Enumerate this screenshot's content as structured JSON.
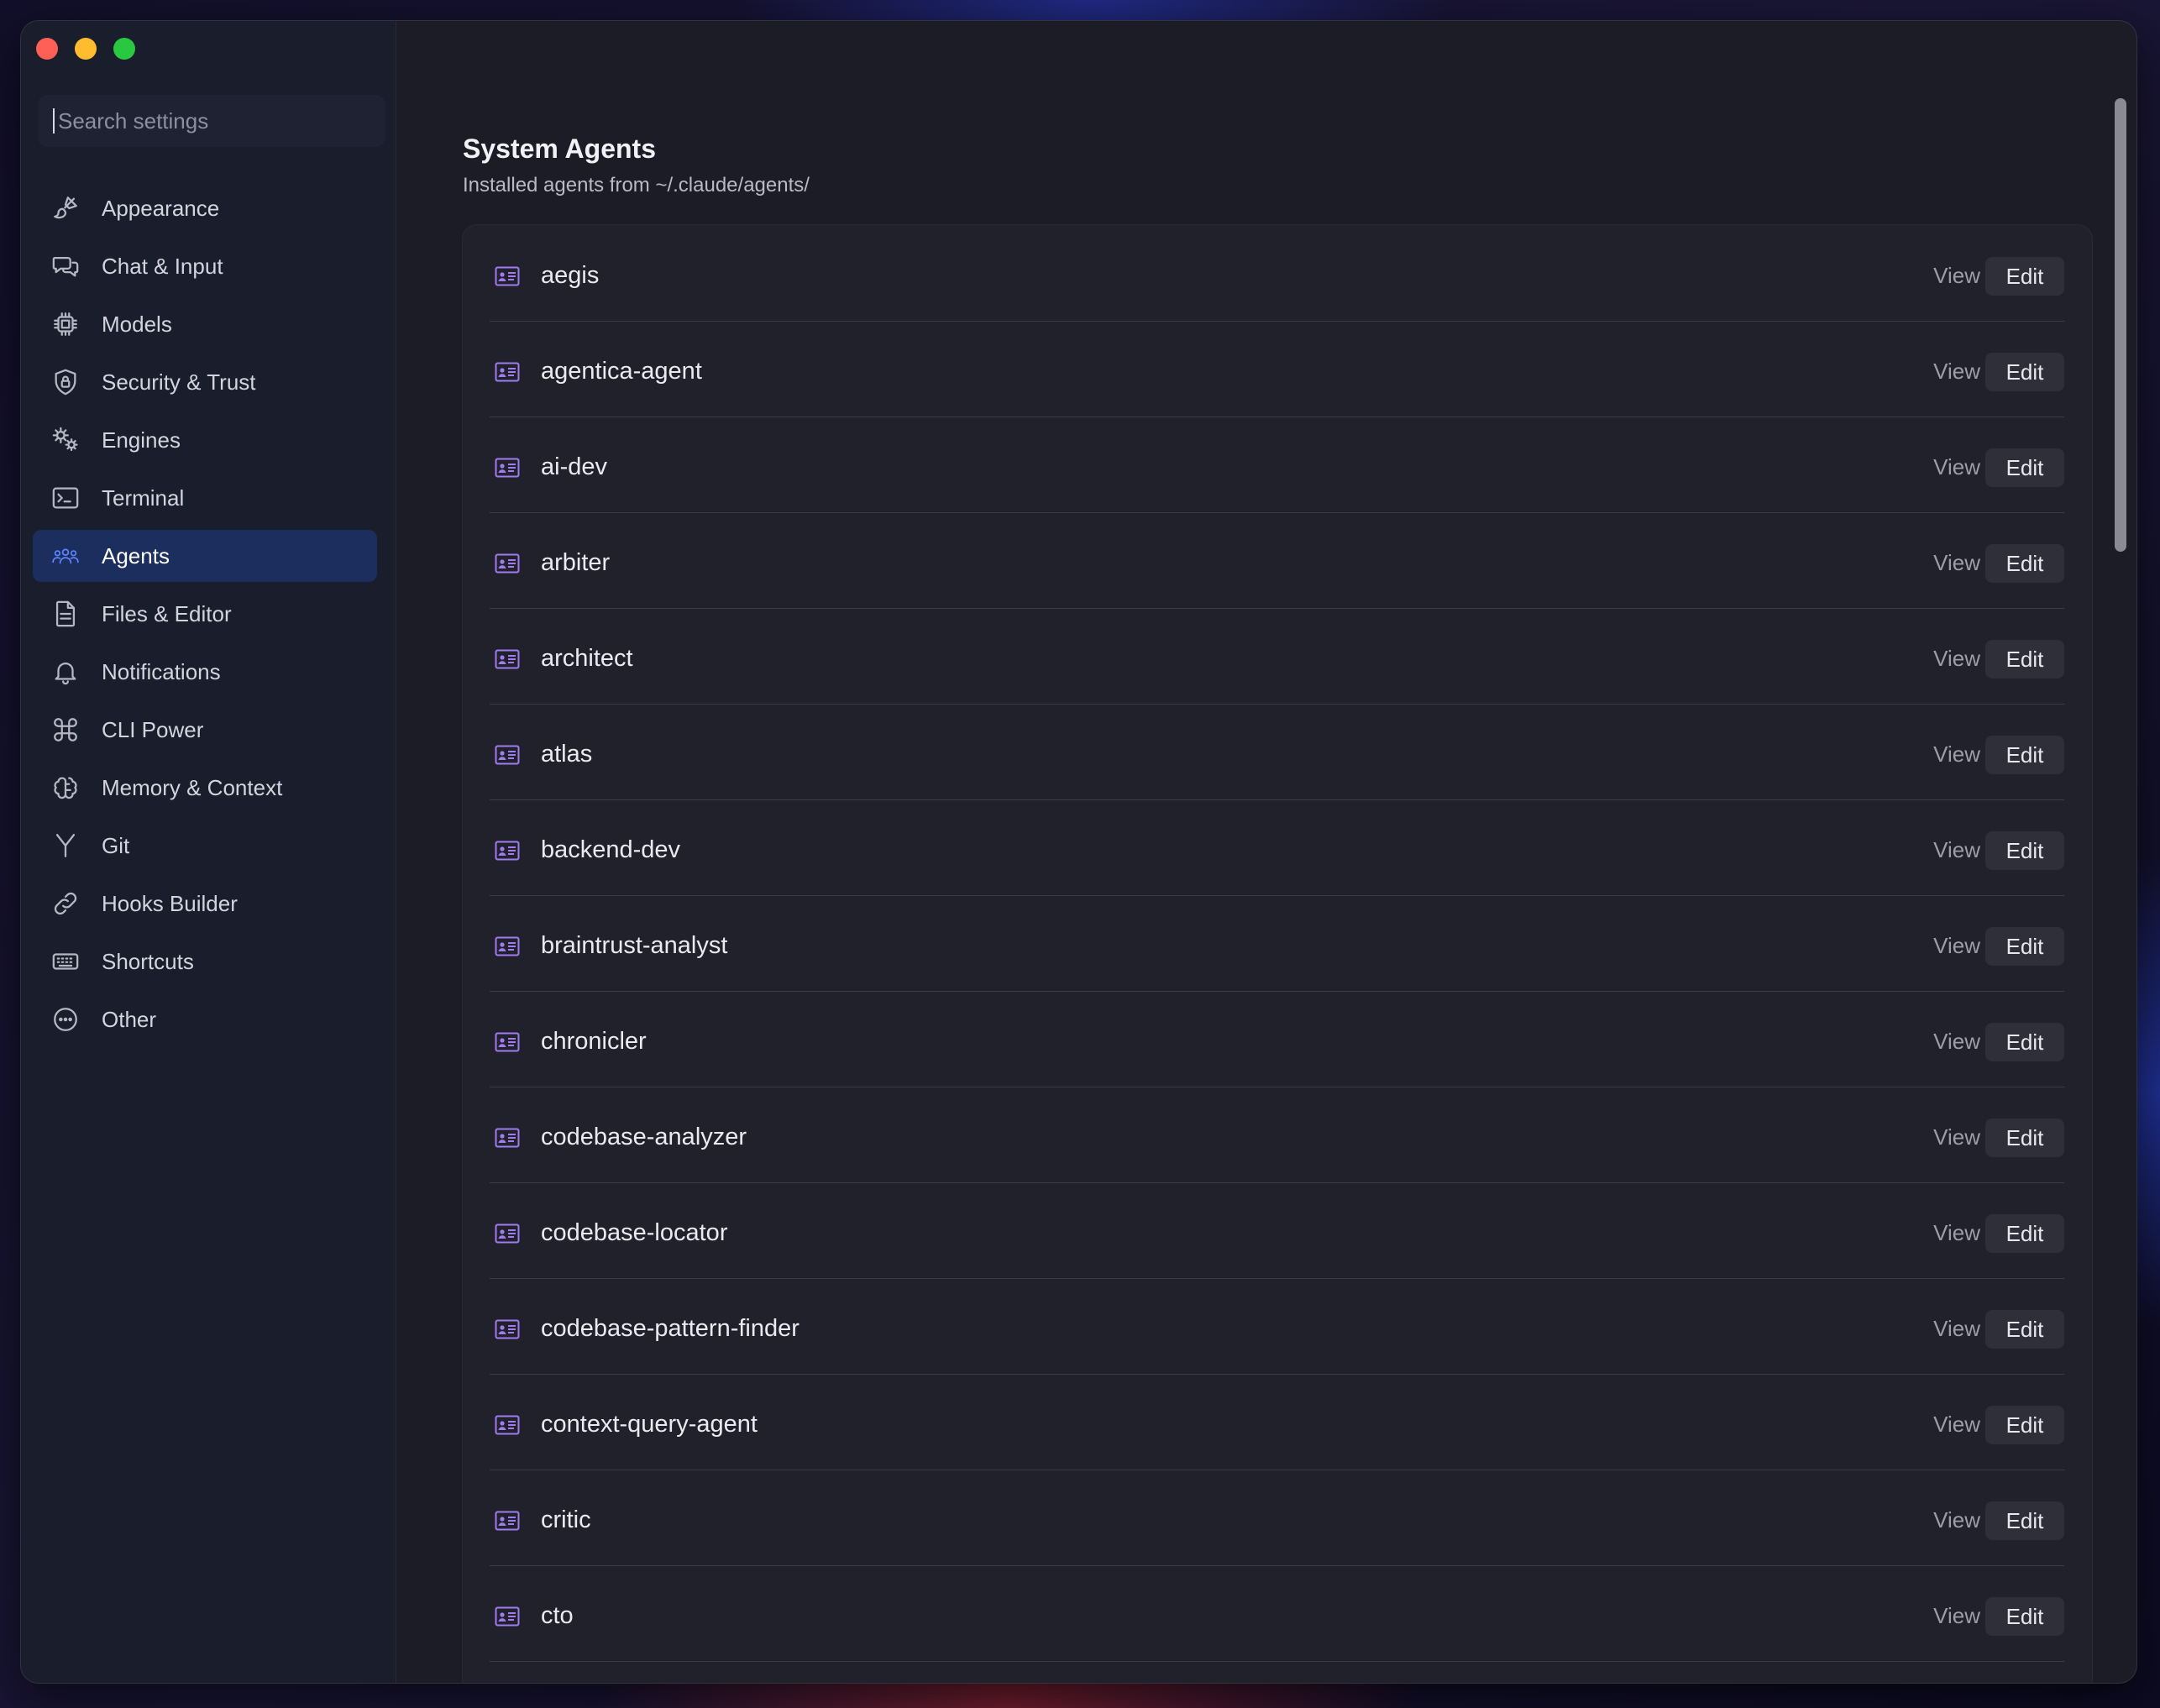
{
  "window": {
    "traffic_lights": [
      {
        "name": "close",
        "color": "#fe5f57"
      },
      {
        "name": "minimize",
        "color": "#febc2e"
      },
      {
        "name": "zoom",
        "color": "#28c840"
      }
    ]
  },
  "sidebar": {
    "search_placeholder": "Search settings",
    "items": [
      {
        "label": "Appearance",
        "icon": "paintbrush-icon",
        "active": false
      },
      {
        "label": "Chat & Input",
        "icon": "chat-bubbles-icon",
        "active": false
      },
      {
        "label": "Models",
        "icon": "cpu-chip-icon",
        "active": false
      },
      {
        "label": "Security & Trust",
        "icon": "shield-lock-icon",
        "active": false
      },
      {
        "label": "Engines",
        "icon": "gears-icon",
        "active": false
      },
      {
        "label": "Terminal",
        "icon": "terminal-icon",
        "active": false
      },
      {
        "label": "Agents",
        "icon": "people-icon",
        "active": true
      },
      {
        "label": "Files & Editor",
        "icon": "document-icon",
        "active": false
      },
      {
        "label": "Notifications",
        "icon": "bell-icon",
        "active": false
      },
      {
        "label": "CLI Power",
        "icon": "command-key-icon",
        "active": false
      },
      {
        "label": "Memory & Context",
        "icon": "brain-icon",
        "active": false
      },
      {
        "label": "Git",
        "icon": "git-branch-icon",
        "active": false
      },
      {
        "label": "Hooks Builder",
        "icon": "link-icon",
        "active": false
      },
      {
        "label": "Shortcuts",
        "icon": "keyboard-icon",
        "active": false
      },
      {
        "label": "Other",
        "icon": "ellipsis-circle-icon",
        "active": false
      }
    ]
  },
  "main": {
    "title": "System Agents",
    "subtitle": "Installed agents from ~/.claude/agents/",
    "view_label": "View",
    "edit_label": "Edit",
    "agents": [
      "aegis",
      "agentica-agent",
      "ai-dev",
      "arbiter",
      "architect",
      "atlas",
      "backend-dev",
      "braintrust-analyst",
      "chronicler",
      "codebase-analyzer",
      "codebase-locator",
      "codebase-pattern-finder",
      "context-query-agent",
      "critic",
      "cto"
    ]
  },
  "colors": {
    "accent": "#5f86ff",
    "agent_icon": "#a07cf0",
    "active_nav_bg": "#1b2e5e"
  }
}
